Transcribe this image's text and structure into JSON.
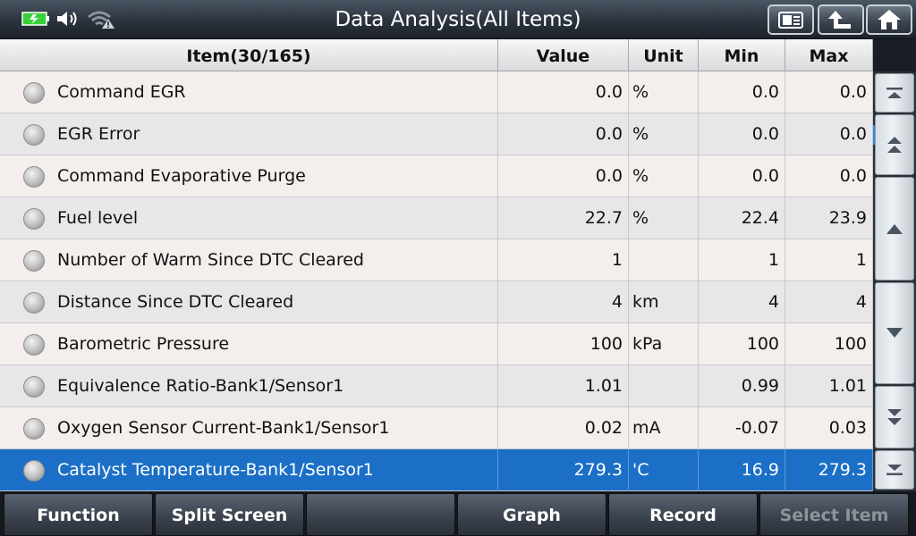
{
  "header": {
    "title": "Data Analysis(All Items)"
  },
  "table": {
    "columns": {
      "item": "Item(30/165)",
      "value": "Value",
      "unit": "Unit",
      "min": "Min",
      "max": "Max"
    },
    "rows": [
      {
        "item": "Command EGR",
        "value": "0.0",
        "unit": "%",
        "min": "0.0",
        "max": "0.0"
      },
      {
        "item": "EGR Error",
        "value": "0.0",
        "unit": "%",
        "min": "0.0",
        "max": "0.0"
      },
      {
        "item": "Command Evaporative Purge",
        "value": "0.0",
        "unit": "%",
        "min": "0.0",
        "max": "0.0"
      },
      {
        "item": "Fuel level",
        "value": "22.7",
        "unit": "%",
        "min": "22.4",
        "max": "23.9"
      },
      {
        "item": "Number of Warm Since DTC Cleared",
        "value": "1",
        "unit": "",
        "min": "1",
        "max": "1"
      },
      {
        "item": "Distance Since DTC Cleared",
        "value": "4",
        "unit": "km",
        "min": "4",
        "max": "4"
      },
      {
        "item": "Barometric Pressure",
        "value": "100",
        "unit": "kPa",
        "min": "100",
        "max": "100"
      },
      {
        "item": "Equivalence Ratio-Bank1/Sensor1",
        "value": "1.01",
        "unit": "",
        "min": "0.99",
        "max": "1.01"
      },
      {
        "item": "Oxygen Sensor Current-Bank1/Sensor1",
        "value": "0.02",
        "unit": "mA",
        "min": "-0.07",
        "max": "0.03"
      },
      {
        "item": "Catalyst Temperature-Bank1/Sensor1",
        "value": "279.3",
        "unit": "'C",
        "min": "16.9",
        "max": "279.3"
      }
    ]
  },
  "footer": {
    "buttons": [
      "Function",
      "Split Screen",
      "",
      "Graph",
      "Record",
      "Select Item"
    ]
  },
  "colors": {
    "selected_row": "#1b6fc6",
    "battery": "#36d13a",
    "scroll_indicator": "#2b8be8"
  },
  "icons": [
    "battery-icon",
    "volume-icon",
    "wifi-warning-icon",
    "screenshot-icon",
    "back-icon",
    "home-icon",
    "scroll-top-icon",
    "page-up-icon",
    "line-up-icon",
    "line-down-icon",
    "page-down-icon",
    "scroll-bottom-icon"
  ]
}
